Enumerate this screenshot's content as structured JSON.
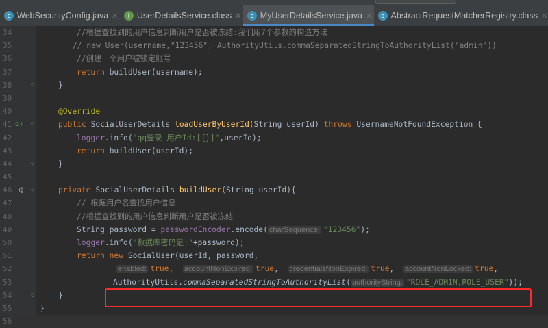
{
  "tabs": [
    {
      "label": "WebSecurityConfig.java",
      "icon": "c",
      "active": false
    },
    {
      "label": "UserDetailsService.class",
      "icon": "i",
      "active": false
    },
    {
      "label": "MyUserDetailsService.java",
      "icon": "c",
      "active": true
    },
    {
      "label": "AbstractRequestMatcherRegistry.class",
      "icon": "c",
      "active": false
    }
  ],
  "lines": [
    {
      "n": "34",
      "indent": 2,
      "t": [
        [
          "cm",
          "//根据查找到的用户信息判断用户是否被冻结:我们用7个参数的构造方法"
        ]
      ]
    },
    {
      "n": "35",
      "indent": 2,
      "off": -6,
      "t": [
        [
          "cm",
          "// new User(username,\"123456\", AuthorityUtils.commaSeparatedStringToAuthorityList(\"admin\"))"
        ]
      ]
    },
    {
      "n": "36",
      "indent": 2,
      "t": [
        [
          "cm",
          "//创建一个用户被锁定账号"
        ]
      ]
    },
    {
      "n": "37",
      "indent": 2,
      "t": [
        [
          "kw",
          "return "
        ],
        [
          "",
          "buildUser(username);"
        ]
      ]
    },
    {
      "n": "38",
      "indent": 1,
      "fold": true,
      "t": [
        [
          "",
          "}"
        ]
      ]
    },
    {
      "n": "39",
      "indent": 0,
      "t": []
    },
    {
      "n": "40",
      "indent": 1,
      "t": [
        [
          "ann",
          "@Override"
        ]
      ]
    },
    {
      "n": "41",
      "indent": 1,
      "gicon": "override",
      "fold": true,
      "t": [
        [
          "kw",
          "public "
        ],
        [
          "",
          "SocialUserDetails "
        ],
        [
          "fn",
          "loadUserByUserId"
        ],
        [
          "",
          "(String userId) "
        ],
        [
          "kw",
          "throws "
        ],
        [
          "",
          "UsernameNotFoundException {"
        ]
      ]
    },
    {
      "n": "42",
      "indent": 2,
      "t": [
        [
          "field",
          "logger"
        ],
        [
          "",
          ".info("
        ],
        [
          "str",
          "\"qq登录 用户Id:[{}]\""
        ],
        [
          "",
          ",userId);"
        ]
      ]
    },
    {
      "n": "43",
      "indent": 2,
      "t": [
        [
          "kw",
          "return "
        ],
        [
          "",
          "buildUser(userId);"
        ]
      ]
    },
    {
      "n": "44",
      "indent": 1,
      "fold": true,
      "t": [
        [
          "",
          "}"
        ]
      ]
    },
    {
      "n": "45",
      "indent": 0,
      "t": []
    },
    {
      "n": "46",
      "indent": 1,
      "gicon": "at",
      "fold": true,
      "t": [
        [
          "kw",
          "private "
        ],
        [
          "",
          "SocialUserDetails "
        ],
        [
          "fn",
          "buildUser"
        ],
        [
          "",
          "(String userId){"
        ]
      ]
    },
    {
      "n": "47",
      "indent": 2,
      "t": [
        [
          "cm",
          "// 根据用户名查找用户信息"
        ]
      ]
    },
    {
      "n": "48",
      "indent": 2,
      "t": [
        [
          "cm",
          "//根据查找到的用户信息判断用户是否被冻结"
        ]
      ]
    },
    {
      "n": "49",
      "indent": 2,
      "t": [
        [
          "",
          "String password = "
        ],
        [
          "field",
          "passwordEncoder"
        ],
        [
          "",
          ".encode("
        ],
        [
          "hint",
          "charSequence:"
        ],
        [
          "str",
          "\"123456\""
        ],
        [
          "",
          ");"
        ]
      ]
    },
    {
      "n": "50",
      "indent": 2,
      "t": [
        [
          "field",
          "logger"
        ],
        [
          "",
          ".info("
        ],
        [
          "str",
          "\"数据库密码是:\""
        ],
        [
          "",
          "+password);"
        ]
      ]
    },
    {
      "n": "51",
      "indent": 2,
      "t": [
        [
          "kw",
          "return new "
        ],
        [
          "",
          "SocialUser(userId, password,"
        ]
      ]
    },
    {
      "n": "52",
      "t": [
        [
          "hint",
          "enabled:"
        ],
        [
          "kw",
          "true"
        ],
        [
          "",
          ",  "
        ],
        [
          "hint",
          "accountNonExpired:"
        ],
        [
          "kw",
          "true"
        ],
        [
          "",
          ",  "
        ],
        [
          "hint",
          "credentialsNonExpired:"
        ],
        [
          "kw",
          "true"
        ],
        [
          "",
          ",  "
        ],
        [
          "hint",
          "accountNonLocked:"
        ],
        [
          "kw",
          "true"
        ],
        [
          "",
          ","
        ]
      ]
    },
    {
      "n": "53",
      "t": [
        [
          "",
          "AuthorityUtils."
        ],
        [
          "it",
          "commaSeparatedStringToAuthorityList"
        ],
        [
          "",
          "("
        ],
        [
          "hint",
          "authorityString:"
        ],
        [
          "str",
          "\"ROLE_ADMIN,ROLE_USER\""
        ],
        [
          "",
          "));"
        ]
      ]
    },
    {
      "n": "54",
      "indent": 1,
      "fold": true,
      "t": [
        [
          "",
          "}"
        ]
      ]
    },
    {
      "n": "55",
      "indent": 0,
      "t": [
        [
          "",
          "}"
        ]
      ]
    },
    {
      "n": "56",
      "indent": 0,
      "cur": true,
      "t": []
    }
  ]
}
